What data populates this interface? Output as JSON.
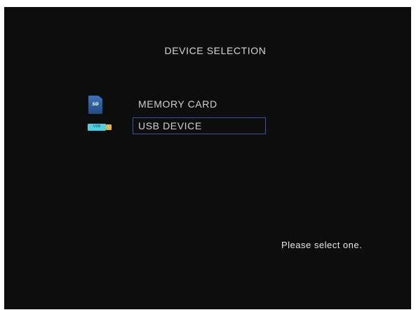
{
  "screen": {
    "title": "DEVICE SELECTION",
    "hint": "Please select one."
  },
  "devices": [
    {
      "label": "MEMORY CARD",
      "icon": "sd-card-icon",
      "icon_text": "SD",
      "selected": false
    },
    {
      "label": "USB DEVICE",
      "icon": "usb-drive-icon",
      "icon_text": "USB",
      "selected": true
    }
  ],
  "colors": {
    "background": "#0d0d0d",
    "text": "#d0d0d0",
    "selection_border": "#3a4fae",
    "sd_icon": "#2a5d9c",
    "usb_icon": "#4fcfe0"
  }
}
